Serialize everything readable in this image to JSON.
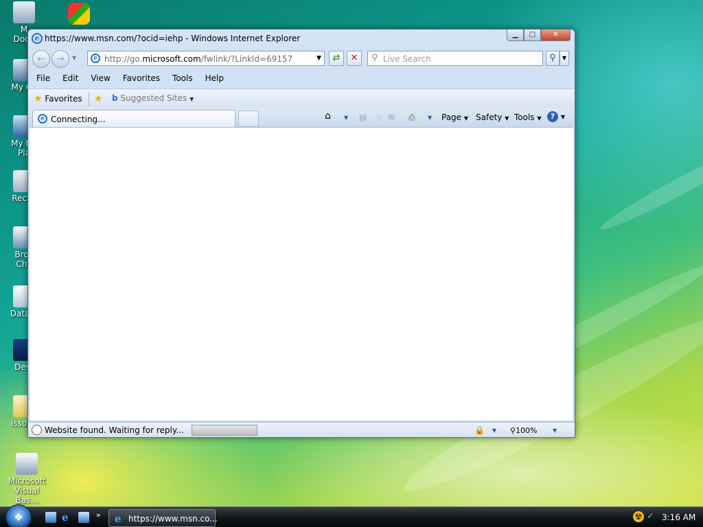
{
  "desktop": {
    "icons": [
      {
        "label": "M\nDocu"
      },
      {
        "label": ""
      },
      {
        "label": "My Co"
      },
      {
        "label": "My Ne\nPla"
      },
      {
        "label": "Recyc"
      },
      {
        "label": "Brov\nCho"
      },
      {
        "label": "DataW"
      },
      {
        "label": "Dev-"
      },
      {
        "label": "issopa"
      },
      {
        "label": "Microsoft\nVisual Bas..."
      }
    ]
  },
  "window": {
    "title": "https://www.msn.com/?ocid=iehp - Windows Internet Explorer",
    "buttons": {
      "minimize": "▁",
      "maximize": "□",
      "close": "✕"
    }
  },
  "navigation": {
    "back_icon": "back-arrow-icon",
    "forward_icon": "forward-arrow-icon",
    "address_prefix": "http://go.",
    "address_domain": "microsoft.com",
    "address_suffix": "/fwlink/?LinkId=69157",
    "search_placeholder": "Live Search"
  },
  "menu": [
    "File",
    "Edit",
    "View",
    "Favorites",
    "Tools",
    "Help"
  ],
  "favorites_bar": {
    "favorites_label": "Favorites",
    "suggested_label": "Suggested Sites"
  },
  "tab": {
    "label": "Connecting..."
  },
  "command_bar": {
    "page": "Page",
    "safety": "Safety",
    "tools": "Tools",
    "help": "?"
  },
  "status": {
    "text": "Website found. Waiting for reply...",
    "zoom": "100%"
  },
  "taskbar": {
    "task_label": "https://www.msn.co...",
    "clock": "3:16 AM"
  },
  "colors": {
    "ie_blue": "#1f6fd0",
    "window_frame": "#bcd3ec",
    "close_red": "#c4442b"
  }
}
